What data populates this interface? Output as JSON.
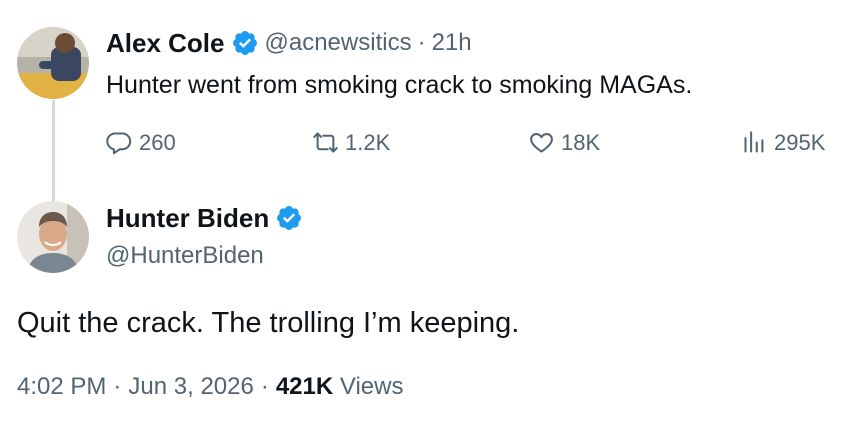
{
  "parent_tweet": {
    "author_name": "Alex Cole",
    "handle": "@acnewsitics",
    "separator": "·",
    "time_ago": "21h",
    "text": "Hunter went from smoking crack to smoking MAGAs.",
    "actions": {
      "replies": "260",
      "reposts": "1.2K",
      "likes": "18K",
      "views": "295K"
    }
  },
  "reply_tweet": {
    "author_name": "Hunter Biden",
    "handle": "@HunterBiden",
    "text": "Quit the crack. The trolling I’m keeping.",
    "meta": {
      "time": "4:02 PM",
      "sep1": "·",
      "date": "Jun 3, 2026",
      "sep2": "·",
      "views_count": "421K",
      "views_label": "Views"
    }
  },
  "colors": {
    "verified_blue": "#1d9bf0",
    "muted_text": "#536471",
    "thread_line": "#cfd9de"
  },
  "icons": [
    "verified-badge-icon",
    "reply-icon",
    "repost-icon",
    "like-icon",
    "views-icon"
  ]
}
